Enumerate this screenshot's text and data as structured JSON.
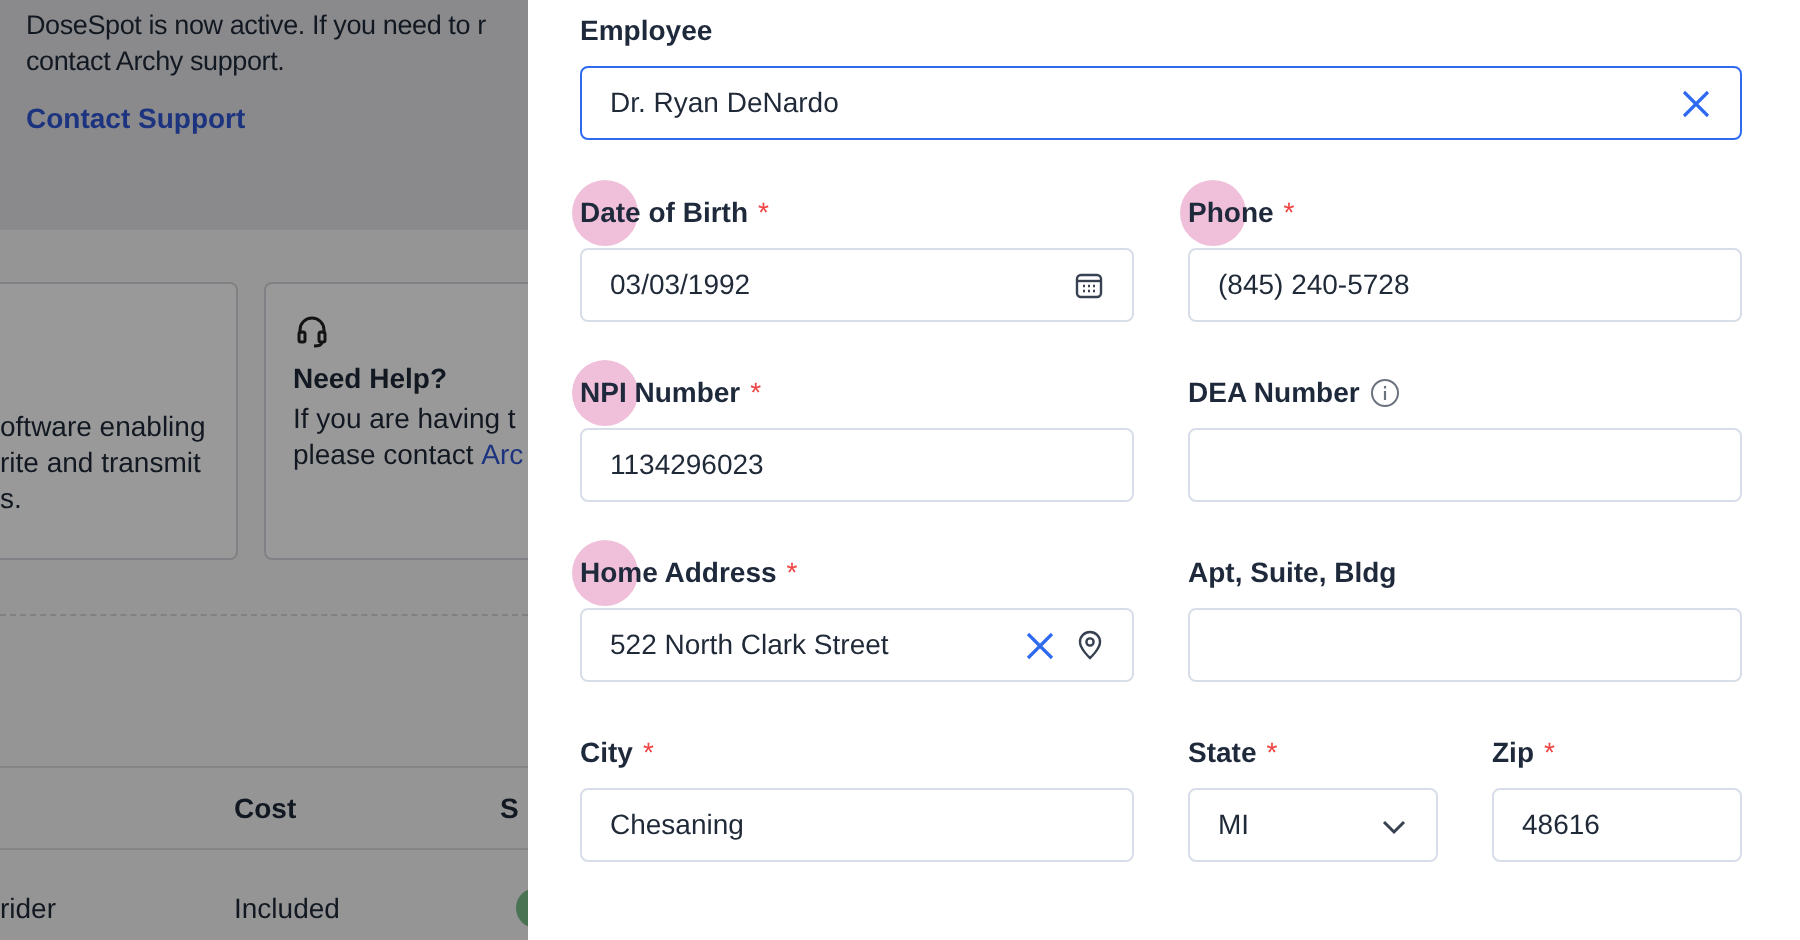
{
  "background_page": {
    "notice": {
      "lines": [
        "DoseSpot is now active. If you need to r",
        "contact Archy support."
      ],
      "link": "Contact Support"
    },
    "cards": [
      {
        "lines": [
          "oftware enabling",
          "rite and transmit",
          "s."
        ]
      },
      {
        "title": "Need Help?",
        "lines": [
          "If you are having t"
        ],
        "text": "please contact ",
        "link": "Arc"
      }
    ],
    "table": {
      "columns": [
        "",
        "Cost",
        "S"
      ],
      "rows": [
        {
          "cells": [
            "rider",
            "Included"
          ]
        }
      ]
    }
  },
  "form": {
    "employee": {
      "label": "Employee",
      "value": "Dr. Ryan DeNardo",
      "focused": true
    },
    "rows": [
      [
        {
          "kind": "date",
          "label": "Date of Birth",
          "required_mark": "*",
          "highlighted": true,
          "value": "03/03/1992"
        },
        {
          "kind": "text",
          "label": "Phone",
          "required_mark": "*",
          "highlighted": true,
          "value": "(845) 240-5728"
        }
      ],
      [
        {
          "kind": "text",
          "label": "NPI Number",
          "required_mark": "*",
          "highlighted": true,
          "value": "1134296023"
        },
        {
          "kind": "text",
          "label": "DEA Number",
          "info": true
        }
      ],
      [
        {
          "kind": "address",
          "label": "Home Address",
          "required_mark": "*",
          "highlighted": true,
          "value": "522 North Clark Street"
        },
        {
          "kind": "text",
          "label": "Apt, Suite, Bldg"
        }
      ],
      [
        {
          "kind": "text",
          "label": "City",
          "required_mark": "*",
          "value": "Chesaning"
        },
        {
          "kind": "select",
          "label": "State",
          "required_mark": "*",
          "value": "MI"
        },
        {
          "kind": "text",
          "label": "Zip",
          "required_mark": "*",
          "value": "48616"
        }
      ]
    ]
  }
}
